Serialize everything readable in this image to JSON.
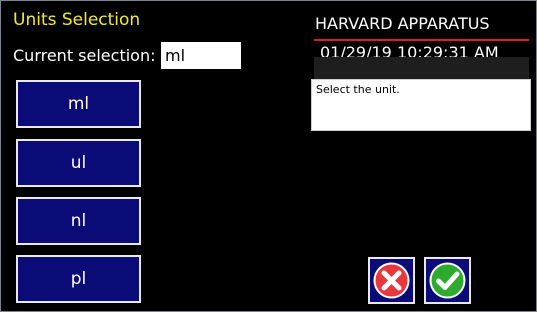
{
  "header": {
    "title": "Units Selection",
    "brand": "HARVARD APPARATUS",
    "datetime": "01/29/19 10:29:31 AM"
  },
  "current_selection": {
    "label": "Current selection:",
    "value": "ml"
  },
  "message": "Select the unit.",
  "units": [
    {
      "label": "ml"
    },
    {
      "label": "ul"
    },
    {
      "label": "nl"
    },
    {
      "label": "pl"
    }
  ],
  "actions": {
    "cancel_icon": "x-circle-icon",
    "confirm_icon": "check-circle-icon"
  },
  "colors": {
    "title": "#f5ee20",
    "button_fill": "#0b0b78",
    "brand_underline": "#d92020",
    "cancel": "#e8383d",
    "confirm": "#2eaa2e"
  }
}
